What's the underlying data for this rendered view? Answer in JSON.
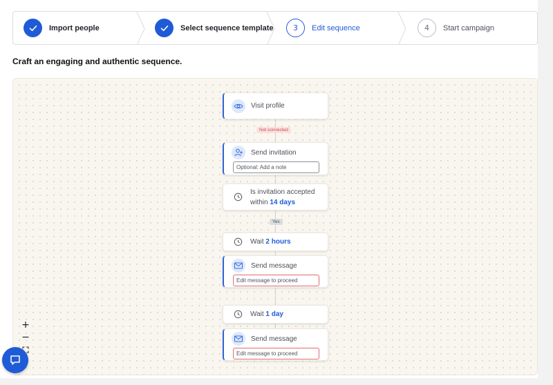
{
  "stepper": {
    "steps": [
      {
        "number": "",
        "label": "Import people",
        "state": "done"
      },
      {
        "number": "",
        "label": "Select sequence template",
        "state": "done"
      },
      {
        "number": "3",
        "label": "Edit sequence",
        "state": "active"
      },
      {
        "number": "4",
        "label": "Start campaign",
        "state": "pending"
      }
    ]
  },
  "subtitle": "Craft an engaging and authentic sequence.",
  "sequence": {
    "visit_profile": {
      "label": "Visit profile",
      "icon": "eye-icon"
    },
    "not_connected_tag": "Not connected",
    "send_invitation": {
      "label": "Send invitation",
      "icon": "add-user-icon",
      "note_placeholder": "Optional: Add a note"
    },
    "is_accepted": {
      "label_line1": "Is invitation accepted",
      "label_prefix": "within",
      "value": "14 days",
      "icon": "clock-icon"
    },
    "yes_tag": "Yes",
    "wait_1": {
      "prefix": "Wait",
      "value": "2 hours",
      "icon": "clock-icon"
    },
    "message_1": {
      "label": "Send message",
      "icon": "envelope-icon",
      "field": "Edit message to proceed"
    },
    "wait_2": {
      "prefix": "Wait",
      "value": "1 day",
      "icon": "clock-icon"
    },
    "message_2": {
      "label": "Send message",
      "icon": "envelope-icon",
      "field": "Edit message to proceed"
    }
  },
  "zoom_controls": {
    "zoom_in": "+",
    "zoom_out": "−"
  },
  "colors": {
    "accent": "#1f5bd6",
    "canvas_bg": "#f9f6f0",
    "error": "#e06b6b"
  }
}
